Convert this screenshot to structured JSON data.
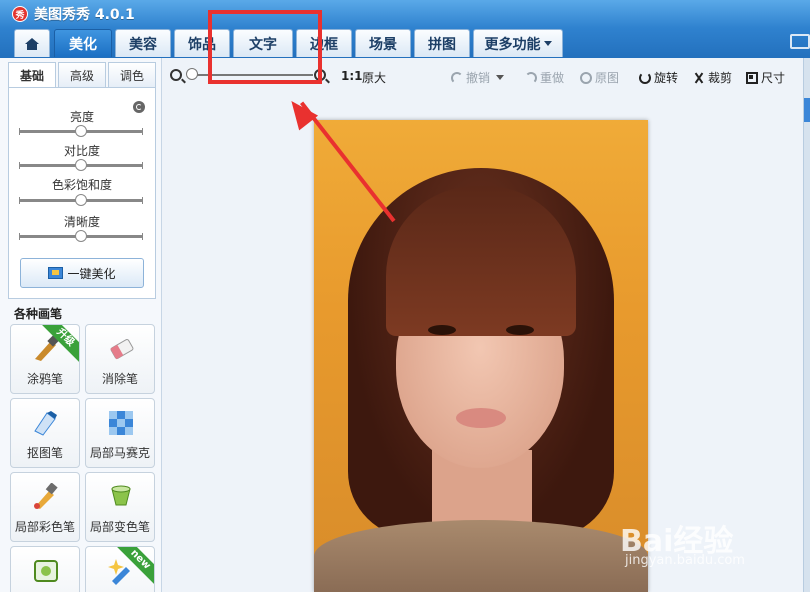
{
  "window": {
    "title": "美图秀秀 4.0.1",
    "logo_char": "秀"
  },
  "tabs": [
    {
      "label": "美化"
    },
    {
      "label": "美容"
    },
    {
      "label": "饰品"
    },
    {
      "label": "文字"
    },
    {
      "label": "边框"
    },
    {
      "label": "场景"
    },
    {
      "label": "拼图"
    },
    {
      "label": "更多功能"
    }
  ],
  "subtabs": [
    {
      "label": "基础"
    },
    {
      "label": "高级"
    },
    {
      "label": "调色"
    }
  ],
  "adjustments": [
    {
      "label": "亮度",
      "value": 0.5
    },
    {
      "label": "对比度",
      "value": 0.5
    },
    {
      "label": "色彩饱和度",
      "value": 0.5
    },
    {
      "label": "清晰度",
      "value": 0.5
    }
  ],
  "beautify_button": "一键美化",
  "brushes": {
    "title": "各种画笔",
    "items": [
      {
        "label": "涂鸦笔",
        "badge": "升级",
        "icon": "paintbrush-icon"
      },
      {
        "label": "消除笔",
        "badge": "",
        "icon": "eraser-icon"
      },
      {
        "label": "抠图笔",
        "badge": "",
        "icon": "cutout-pen-icon"
      },
      {
        "label": "局部马赛克",
        "badge": "",
        "icon": "mosaic-icon"
      },
      {
        "label": "局部彩色笔",
        "badge": "",
        "icon": "color-brush-icon"
      },
      {
        "label": "局部变色笔",
        "badge": "",
        "icon": "color-change-icon"
      },
      {
        "label": "",
        "badge": "",
        "icon": "frame-brush-icon"
      },
      {
        "label": "",
        "badge": "new",
        "icon": "magic-brush-icon"
      }
    ]
  },
  "toolbar": {
    "zoom_ratio": "1:1",
    "original_size": "原大",
    "undo": "撤销",
    "redo": "重做",
    "original": "原图",
    "rotate": "旋转",
    "crop": "裁剪",
    "size": "尺寸"
  },
  "watermark": {
    "brand": "Bai经验",
    "url": "jingyan.baidu.com"
  },
  "colors": {
    "accent": "#2f82cf",
    "annotation": "#e9312f",
    "badge_green": "#3aa13a"
  }
}
